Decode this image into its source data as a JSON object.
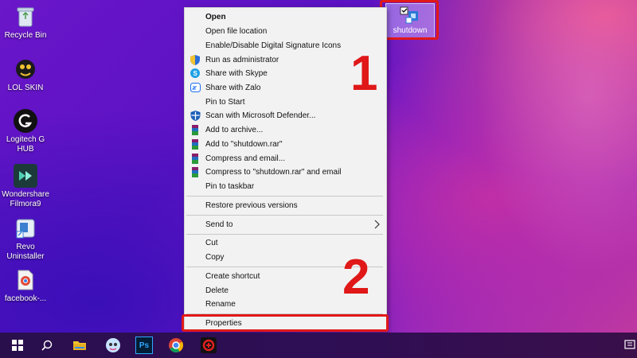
{
  "desktop": {
    "icons": [
      {
        "label": "Recycle Bin"
      },
      {
        "label": "LOL SKIN"
      },
      {
        "label": "Logitech G HUB"
      },
      {
        "label": "Wondershare Filmora9"
      },
      {
        "label": "Revo Uninstaller"
      },
      {
        "label": "facebook-..."
      }
    ],
    "selected_icon": {
      "label": "shutdown"
    }
  },
  "annotations": {
    "step1": "1",
    "step2": "2",
    "highlight_color": "#e01818"
  },
  "context_menu": {
    "open": "Open",
    "open_file_location": "Open file location",
    "digital_signature": "Enable/Disable Digital Signature Icons",
    "run_as_admin": "Run as administrator",
    "share_skype": "Share with Skype",
    "share_zalo": "Share with Zalo",
    "pin_start": "Pin to Start",
    "scan_defender": "Scan with Microsoft Defender...",
    "add_archive": "Add to archive...",
    "add_rar": "Add to \"shutdown.rar\"",
    "compress_email": "Compress and email...",
    "compress_rar_email": "Compress to \"shutdown.rar\" and email",
    "pin_taskbar": "Pin to taskbar",
    "restore_versions": "Restore previous versions",
    "send_to": "Send to",
    "cut": "Cut",
    "copy": "Copy",
    "create_shortcut": "Create shortcut",
    "delete": "Delete",
    "rename": "Rename",
    "properties": "Properties"
  },
  "taskbar": {
    "items": [
      "start-icon",
      "search-icon",
      "file-explorer-icon",
      "app-icon",
      "photoshop-icon",
      "chrome-icon",
      "garena-icon"
    ],
    "ps_label": "Ps"
  }
}
